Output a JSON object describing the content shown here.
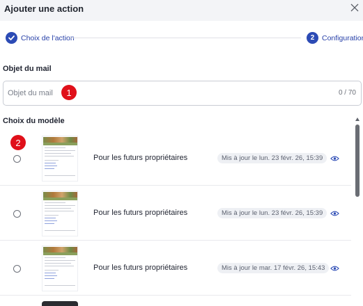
{
  "header": {
    "title": "Ajouter une action"
  },
  "stepper": {
    "steps": [
      {
        "label": "Choix de l'action",
        "state": "done"
      },
      {
        "label": "Configuration",
        "state": "active",
        "icon": "2"
      }
    ]
  },
  "subject": {
    "title": "Objet du mail",
    "placeholder": "Objet du mail",
    "value": "",
    "counter": "0 / 70"
  },
  "model": {
    "title": "Choix du modèle",
    "rows": [
      {
        "title": "Pour les futurs propriétaires",
        "updated": "Mis à jour le lun. 23 févr. 26, 15:39"
      },
      {
        "title": "Pour les futurs propriétaires",
        "updated": "Mis à jour le lun. 23 févr. 26, 15:39"
      },
      {
        "title": "Pour les futurs propriétaires",
        "updated": "Mis à jour le mar. 17 févr. 26, 15:43"
      }
    ]
  },
  "markers": {
    "first": "1",
    "second": "2"
  },
  "colors": {
    "accent": "#2c4bb5",
    "marker": "#e0101a"
  }
}
